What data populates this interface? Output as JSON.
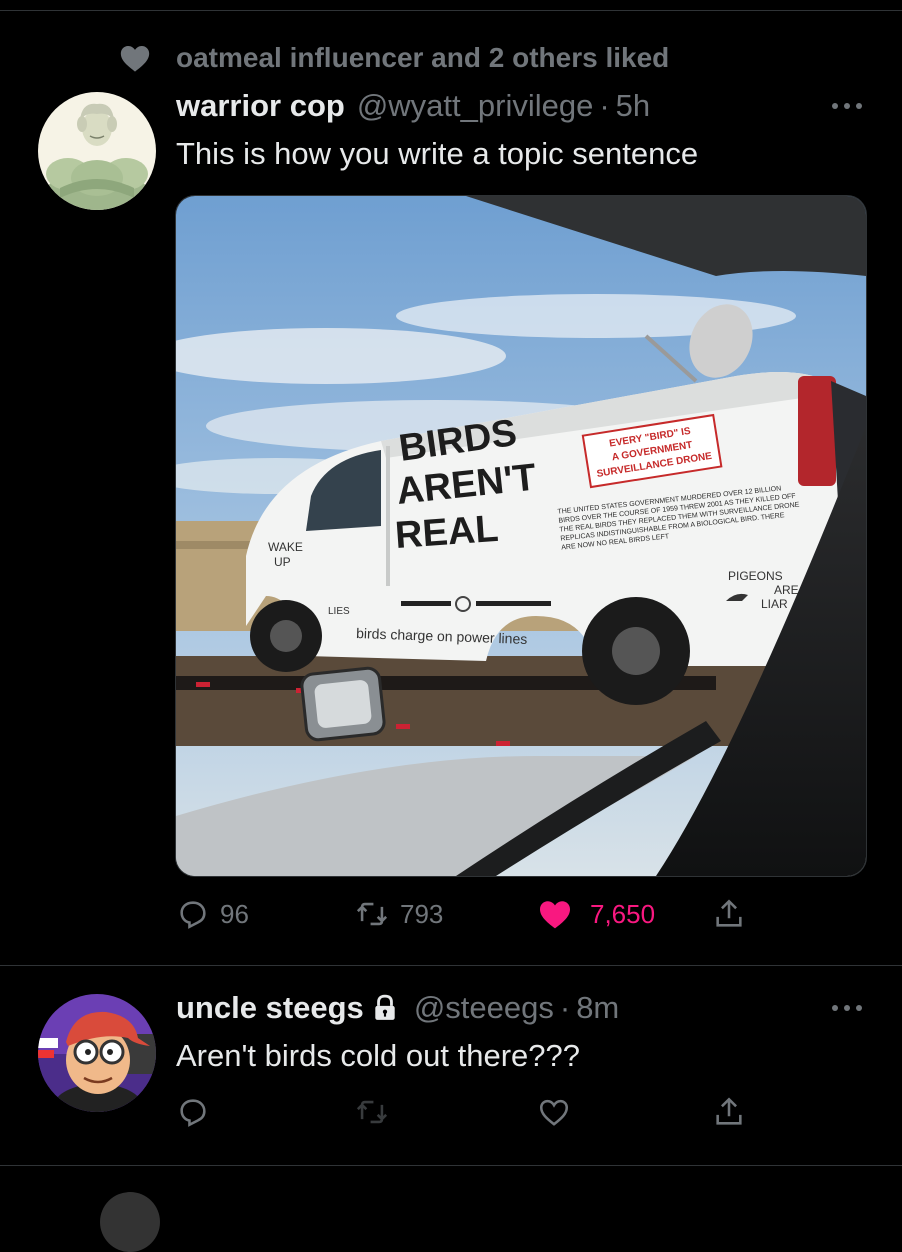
{
  "social_context": {
    "text": "oatmeal influencer and 2 others liked"
  },
  "tweet1": {
    "display_name": "warrior cop",
    "handle": "@wyatt_privilege",
    "separator": "·",
    "time": "5h",
    "text": "This is how you write a topic sentence",
    "image_text": {
      "headline": [
        "BIRDS",
        "AREN'T",
        "REAL"
      ],
      "sticker": [
        "EVERY \"BIRD\" IS",
        "A GOVERNMENT",
        "SURVEILLANCE DRONE"
      ],
      "fine_print": [
        "THE UNITED STATES GOVERNMENT MURDERED OVER 12 BILLION",
        "BIRDS OVER THE COURSE OF 1959 THREW 2001 AS THEY KILLED OFF",
        "THE REAL BIRDS THEY REPLACED THEM WITH SURVEILLANCE DRONE",
        "REPLICAS INDISTINGUISHABLE FROM A BIOLOGICAL BIRD. THERE",
        "ARE NOW NO REAL BIRDS LEFT"
      ],
      "wake_up": [
        "WAKE",
        "UP"
      ],
      "lies": "LIES",
      "bottom": "birds charge on power lines",
      "pigeons": [
        "PIGEONS",
        "ARE",
        "LIAR"
      ]
    },
    "reply_count": "96",
    "retweet_count": "793",
    "like_count": "7,650",
    "liked": true,
    "colors": {
      "like": "#f91880",
      "muted": "#71767b"
    }
  },
  "tweet2": {
    "display_name": "uncle steegs",
    "handle": "@steeegs",
    "separator": "·",
    "time": "8m",
    "text": "Aren't birds cold out there???",
    "protected": true
  }
}
